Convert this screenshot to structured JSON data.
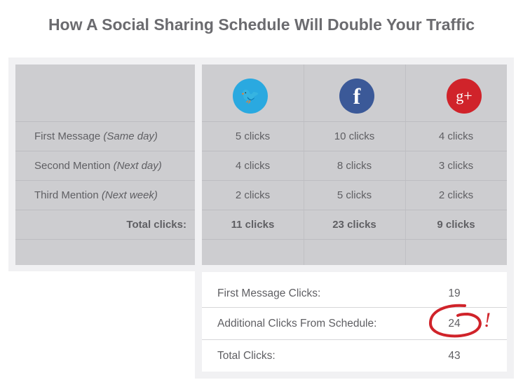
{
  "title": "How A Social Sharing Schedule Will Double Your Traffic",
  "networks": [
    {
      "icon": "twitter-icon",
      "glyph": "🐦",
      "color": "#2aa9e0"
    },
    {
      "icon": "facebook-icon",
      "glyph": "f",
      "color": "#3b5998"
    },
    {
      "icon": "google-plus-icon",
      "glyph": "g+",
      "color": "#d0232a"
    }
  ],
  "rows": [
    {
      "label": "First Message",
      "note": "(Same day)",
      "values": [
        "5 clicks",
        "10 clicks",
        "4 clicks"
      ]
    },
    {
      "label": "Second Mention",
      "note": "(Next day)",
      "values": [
        "4 clicks",
        "8 clicks",
        "3 clicks"
      ]
    },
    {
      "label": "Third Mention",
      "note": "(Next week)",
      "values": [
        "2 clicks",
        "5 clicks",
        "2 clicks"
      ]
    }
  ],
  "totals": {
    "label": "Total clicks:",
    "values": [
      "11 clicks",
      "23 clicks",
      "9 clicks"
    ]
  },
  "summary": [
    {
      "label": "First Message Clicks:",
      "value": "19"
    },
    {
      "label": "Additional Clicks From Schedule:",
      "value": "24"
    },
    {
      "label": "Total Clicks:",
      "value": "43"
    }
  ],
  "annotation": {
    "mark": "!",
    "color": "#d0232a"
  }
}
